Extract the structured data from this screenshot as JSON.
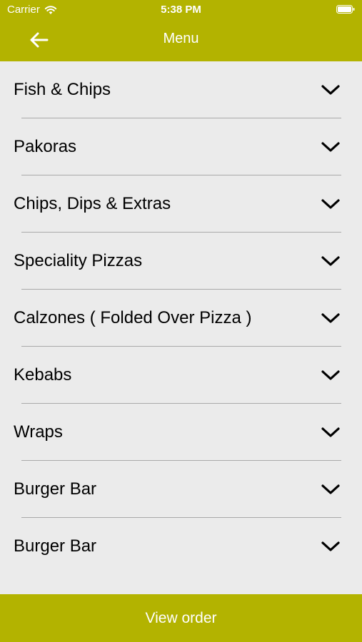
{
  "status_bar": {
    "carrier": "Carrier",
    "time": "5:38 PM",
    "wifi_icon": "wifi-icon",
    "battery_icon": "battery-icon"
  },
  "nav": {
    "title": "Menu",
    "back_icon": "arrow-left-icon"
  },
  "menu": {
    "items": [
      {
        "label": "Fish & Chips",
        "icon": "chevron-down-icon"
      },
      {
        "label": "Pakoras",
        "icon": "chevron-down-icon"
      },
      {
        "label": "Chips, Dips & Extras",
        "icon": "chevron-down-icon"
      },
      {
        "label": "Speciality Pizzas",
        "icon": "chevron-down-icon"
      },
      {
        "label": "Calzones ( Folded Over Pizza )",
        "icon": "chevron-down-icon"
      },
      {
        "label": "Kebabs",
        "icon": "chevron-down-icon"
      },
      {
        "label": "Wraps",
        "icon": "chevron-down-icon"
      },
      {
        "label": "Burger Bar",
        "icon": "chevron-down-icon"
      },
      {
        "label": "Burger Bar",
        "icon": "chevron-down-icon"
      }
    ]
  },
  "footer": {
    "view_order_label": "View order"
  },
  "colors": {
    "accent": "#b3b300",
    "background": "#ebebeb",
    "divider": "#a9a9a9"
  }
}
